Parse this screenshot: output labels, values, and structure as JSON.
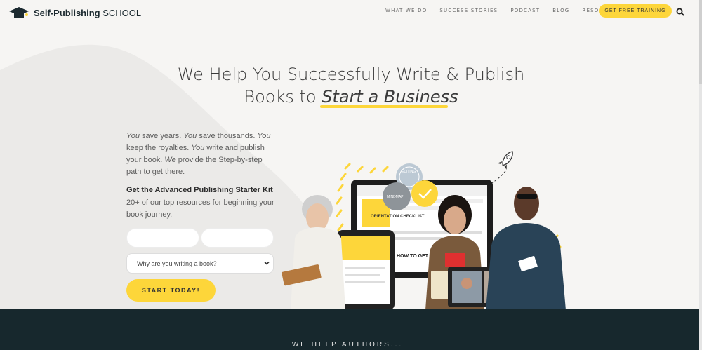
{
  "header": {
    "logo_bold": "Self-Publishing",
    "logo_light": " SCHOOL",
    "nav": [
      "WHAT WE DO",
      "SUCCESS STORIES",
      "PODCAST",
      "BLOG",
      "RESOURCES"
    ],
    "cta": "GET FREE TRAINING"
  },
  "hero": {
    "title_line1": "We Help You Successfully Write & Publish",
    "title_line2_prefix": "Books to ",
    "title_line2_em": "Start a Business"
  },
  "intro": {
    "p1": "You",
    "t1": " save years. ",
    "p2": "You",
    "t2": " save thousands. ",
    "p3": "You",
    "t3": " keep the royalties. ",
    "p4": "You",
    "t4": " write and publish your book. ",
    "p5": "We",
    "t5": " provide the Step-by-step path to get there."
  },
  "kit": {
    "title": "Get the Advanced Publishing Starter Kit",
    "desc": "20+ of our top resources for beginning your book journey."
  },
  "form": {
    "select_value": "Why are you writing a book?",
    "submit": "START TODAY!"
  },
  "illustration": {
    "badge_editing": "EDITING",
    "badge_mindmap": "MINDMAP",
    "screen_heading": "ORIENTATION CHECKLIST",
    "screen_text": "HOW TO GET SUPPORT"
  },
  "band": {
    "text": "WE HELP AUTHORS..."
  },
  "colors": {
    "accent": "#fdd63a",
    "dark": "#17282d",
    "background": "#f6f5f3"
  }
}
